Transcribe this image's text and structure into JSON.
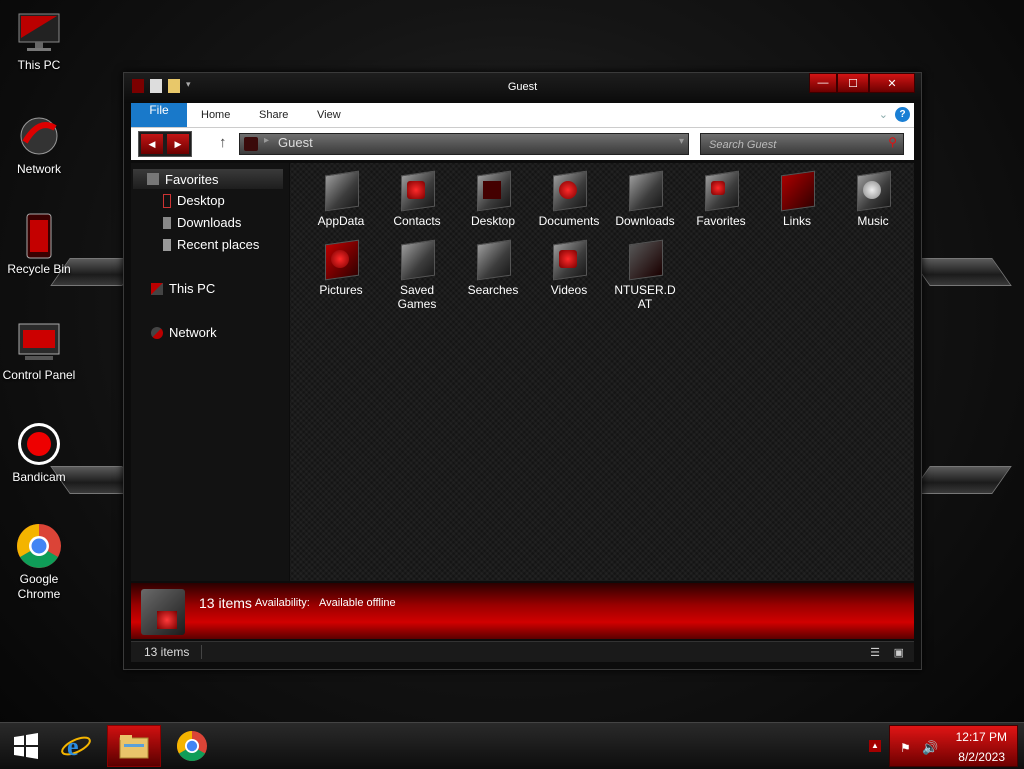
{
  "desktop": {
    "icons": [
      {
        "label": "This PC",
        "icon": "monitor-icon"
      },
      {
        "label": "Network",
        "icon": "network-icon"
      },
      {
        "label": "Recycle Bin",
        "icon": "recycle-bin-icon"
      },
      {
        "label": "Control Panel",
        "icon": "control-panel-icon"
      },
      {
        "label": "Bandicam",
        "icon": "record-icon"
      },
      {
        "label": "Google\nChrome",
        "icon": "chrome-icon"
      }
    ]
  },
  "window": {
    "title": "Guest",
    "controls": {
      "minimize": "—",
      "maximize": "☐",
      "close": "✕"
    }
  },
  "ribbon": {
    "tabs": [
      "File",
      "Home",
      "Share",
      "View"
    ],
    "help": "?"
  },
  "navbar": {
    "back": "◀",
    "forward": "▶",
    "up": "↑",
    "breadcrumb_separator": "▸",
    "address": "Guest",
    "dropdown": "▾",
    "search_placeholder": "Search Guest"
  },
  "navpane": {
    "favorites": "Favorites",
    "favorites_items": [
      "Desktop",
      "Downloads",
      "Recent places"
    ],
    "this_pc": "This PC",
    "network": "Network"
  },
  "files": [
    {
      "name": "AppData"
    },
    {
      "name": "Contacts"
    },
    {
      "name": "Desktop"
    },
    {
      "name": "Documents"
    },
    {
      "name": "Downloads"
    },
    {
      "name": "Favorites"
    },
    {
      "name": "Links"
    },
    {
      "name": "Music"
    },
    {
      "name": "Pictures"
    },
    {
      "name": "Saved Games"
    },
    {
      "name": "Searches"
    },
    {
      "name": "Videos"
    },
    {
      "name": "NTUSER.DAT"
    }
  ],
  "details": {
    "count": "13 items",
    "availability_label": "Availability:",
    "availability_value": "Available offline"
  },
  "status": {
    "items": "13 items"
  },
  "taskbar": {
    "time": "12:17 PM",
    "date": "8/2/2023"
  },
  "colors": {
    "accent_red": "#d10000",
    "file_tab_blue": "#1979ca"
  }
}
